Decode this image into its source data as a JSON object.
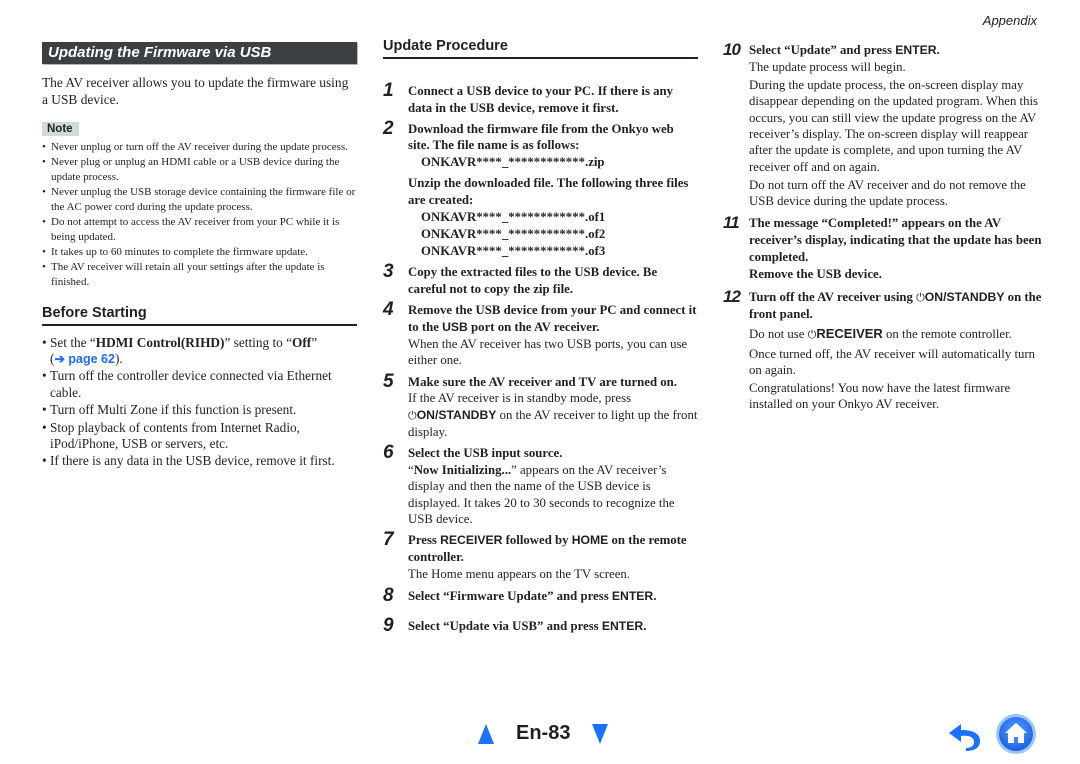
{
  "header": {
    "section": "Appendix"
  },
  "left": {
    "banner": "Updating the Firmware via USB",
    "intro": "The AV receiver allows you to update the firmware using a USB device.",
    "note_label": "Note",
    "notes": [
      "Never unplug or turn off the AV receiver during the update process.",
      "Never plug or unplug an HDMI cable or a USB device during the update process.",
      "Never unplug the USB storage device containing the firmware file or the AC power cord during the update process.",
      "Do not attempt to access the AV receiver from your PC while it is being updated.",
      "It takes up to 60 minutes to complete the firmware update.",
      "The AV receiver will retain all your settings after the update is finished."
    ],
    "before_heading": "Before Starting",
    "before_first": {
      "pre": "Set the “",
      "bold1": "HDMI Control(RIHD)",
      "mid": "” setting to “",
      "bold2": "Off",
      "post": "”",
      "open_paren": "(",
      "link": "➔ page 62",
      "close_paren": ")."
    },
    "before_items": [
      "Turn off the controller device connected via Ethernet cable.",
      "Turn off Multi Zone if this function is present.",
      "Stop playback of contents from Internet Radio, iPod/iPhone, USB or servers, etc.",
      "If there is any data in the USB device, remove it first."
    ]
  },
  "procedure": {
    "heading": "Update Procedure",
    "steps": {
      "s1": {
        "num": "1",
        "title": "Connect a USB device to your PC. If there is any data in the USB device, remove it first."
      },
      "s2": {
        "num": "2",
        "title": "Download the firmware file from the Onkyo web site. The file name is as follows:",
        "zip": "ONKAVR****_************.zip",
        "unzip": "Unzip the downloaded file. The following three files are created:",
        "files": [
          "ONKAVR****_************.of1",
          "ONKAVR****_************.of2",
          "ONKAVR****_************.of3"
        ]
      },
      "s3": {
        "num": "3",
        "title": "Copy the extracted files to the USB device. Be careful not to copy the zip file."
      },
      "s4": {
        "num": "4",
        "title_pre": "Remove the USB device from your PC and connect it to the ",
        "title_key": "USB",
        "title_post": " port on the AV receiver.",
        "body": "When the AV receiver has two USB ports, you can use either one."
      },
      "s5": {
        "num": "5",
        "title": "Make sure the AV receiver and TV are turned on.",
        "body_pre": "If the AV receiver is in standby mode, press",
        "power_icon": "⏻",
        "key": "ON/STANDBY",
        "body_post": " on the AV receiver to light up the front display."
      },
      "s6": {
        "num": "6",
        "title": "Select the USB input source.",
        "body_q1": "“",
        "body_bold": "Now Initializing...",
        "body_post": "” appears on the AV receiver’s display and then the name of the USB device is displayed. It takes 20 to 30 seconds to recognize the USB device."
      },
      "s7": {
        "num": "7",
        "pre": "Press ",
        "key1": "RECEIVER",
        "mid": " followed by ",
        "key2": "HOME",
        "post": " on the remote controller.",
        "body": "The Home menu appears on the TV screen."
      },
      "s8": {
        "num": "8",
        "pre": "Select “Firmware Update” and press ",
        "key": "ENTER",
        "post": "."
      },
      "s9": {
        "num": "9",
        "pre": "Select “Update via USB” and press ",
        "key": "ENTER",
        "post": "."
      },
      "s10": {
        "num": "10",
        "pre": "Select “Update” and press ",
        "key": "ENTER",
        "post": ".",
        "body1": "The update process will begin.",
        "body2": "During the update process, the on-screen display may disappear depending on the updated program. When this occurs, you can still view the update progress on the AV receiver’s display. The on-screen display will reappear after the update is complete, and upon turning the AV receiver off and on again.",
        "body3": "Do not turn off the AV receiver and do not remove the USB device during the update process."
      },
      "s11": {
        "num": "11",
        "title": "The message “Completed!” appears on the AV receiver’s display, indicating that the update has been completed.",
        "title2": "Remove the USB device."
      },
      "s12": {
        "num": "12",
        "pre": "Turn off the AV receiver using ",
        "power_icon": "⏻",
        "key": "ON/STANDBY",
        "post": " on the front panel.",
        "body1_pre": "Do not use ",
        "body1_key": "RECEIVER",
        "body1_post": " on the remote controller.",
        "body2": "Once turned off, the AV receiver will automatically turn on again.",
        "body3": "Congratulations! You now have the latest firmware installed on your Onkyo AV receiver."
      }
    }
  },
  "footer": {
    "page_number": "En-83",
    "prev_icon": "triangle-up",
    "next_icon": "triangle-down",
    "back_icon": "back-arrow",
    "home_icon": "home",
    "accent_color": "#1a73ff"
  }
}
